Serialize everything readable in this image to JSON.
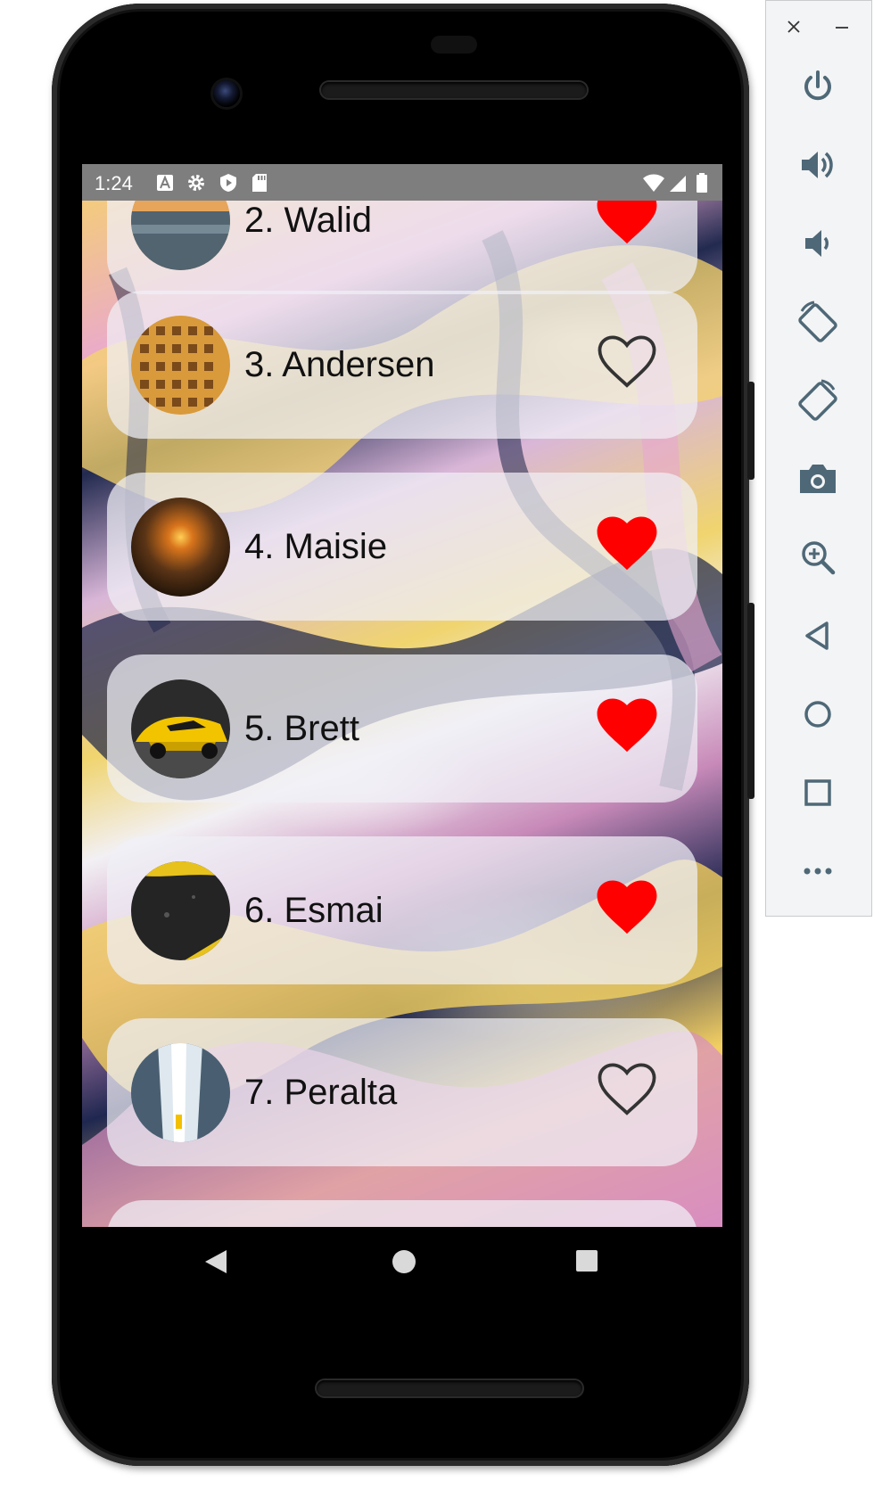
{
  "statusbar": {
    "time": "1:24",
    "icons_left": [
      "font-a-icon",
      "gear-icon",
      "shield-icon",
      "sd-card-icon"
    ],
    "icons_right": [
      "wifi-icon",
      "signal-icon",
      "battery-icon"
    ]
  },
  "list": {
    "items": [
      {
        "name": "2. Walid",
        "favorite": true,
        "avatar": "sea-sunset-image"
      },
      {
        "name": "3. Andersen",
        "favorite": false,
        "avatar": "building-windows-image"
      },
      {
        "name": "4. Maisie",
        "favorite": true,
        "avatar": "sunset-window-image"
      },
      {
        "name": "5. Brett",
        "favorite": true,
        "avatar": "yellow-car-image"
      },
      {
        "name": "6. Esmai",
        "favorite": true,
        "avatar": "dark-road-image"
      },
      {
        "name": "7. Peralta",
        "favorite": false,
        "avatar": "waterfall-image"
      }
    ]
  },
  "colors": {
    "heart_filled": "#ff0000",
    "heart_outline": "#333333",
    "card_bg": "rgba(240,240,246,0.72)",
    "statusbar_bg": "#7e7e7e",
    "toolbar_icon": "#4e6877"
  },
  "navbar": {
    "buttons": [
      "back-triangle-icon",
      "home-circle-icon",
      "recents-square-icon"
    ]
  },
  "emulator_toolbar": {
    "window_controls": [
      "close-icon",
      "minimize-icon"
    ],
    "buttons": [
      "power-icon",
      "volume-up-icon",
      "volume-down-icon",
      "rotate-left-icon",
      "rotate-right-icon",
      "camera-icon",
      "zoom-icon",
      "back-icon",
      "home-icon",
      "overview-icon",
      "more-icon"
    ]
  }
}
